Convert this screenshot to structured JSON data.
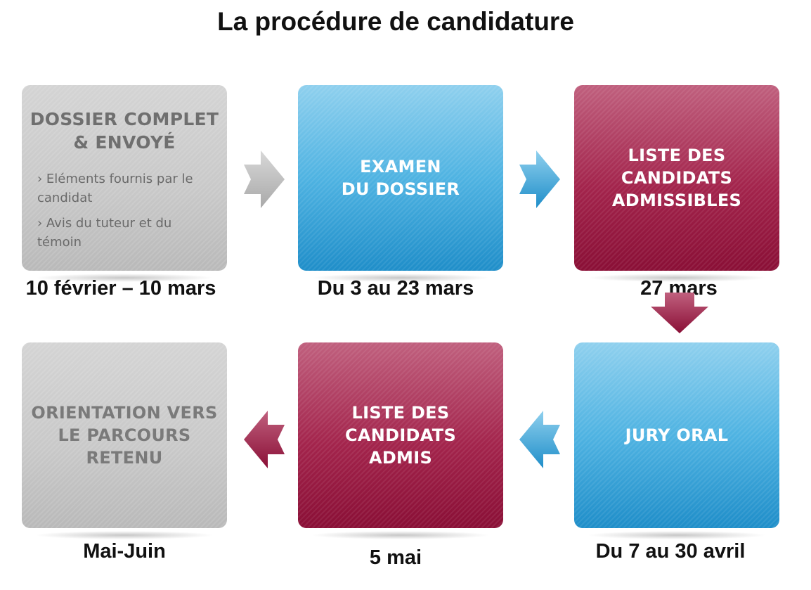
{
  "title": "La procédure de candidature",
  "steps": [
    {
      "title_lines": [
        "DOSSIER COMPLET",
        "& ENVOYÉ"
      ],
      "items": [
        "› Eléments fournis par le candidat",
        "› Avis du tuteur et du témoin"
      ],
      "date": "10 février – 10 mars",
      "color": "#c4c4c4"
    },
    {
      "title_lines": [
        "EXAMEN",
        "DU DOSSIER"
      ],
      "date": "Du 3 au 23 mars",
      "color": "#4fb3e2"
    },
    {
      "title_lines": [
        "LISTE DES",
        "CANDIDATS",
        "ADMISSIBLES"
      ],
      "date": "27 mars",
      "color": "#a3244c"
    },
    {
      "title_lines": [
        "JURY ORAL"
      ],
      "date": "Du 7 au 30 avril",
      "color": "#4fb3e2"
    },
    {
      "title_lines": [
        "LISTE DES",
        "CANDIDATS",
        "ADMIS"
      ],
      "date": "5 mai",
      "color": "#a3244c"
    },
    {
      "title_lines": [
        "ORIENTATION VERS",
        "LE PARCOURS",
        "RETENU"
      ],
      "date": "Mai-Juin",
      "color": "#c4c4c4"
    }
  ]
}
